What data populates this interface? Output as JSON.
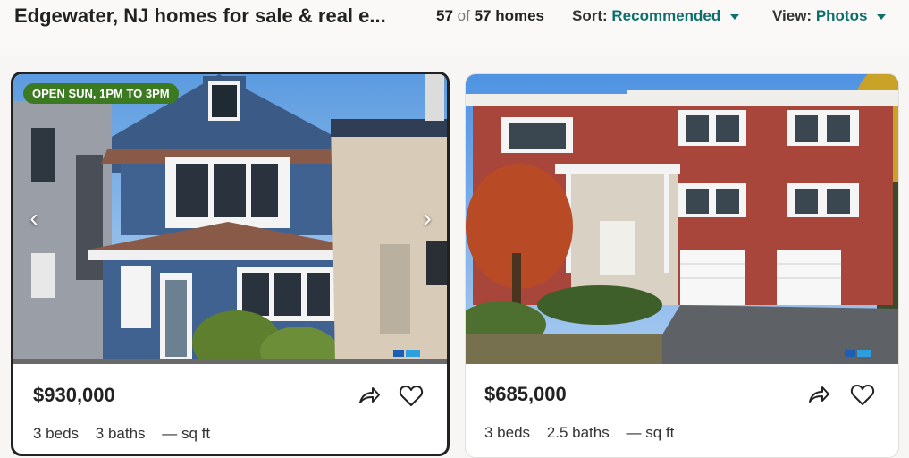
{
  "header": {
    "title": "Edgewater, NJ homes for sale & real e...",
    "count_shown": "57",
    "count_of": "of",
    "count_total": "57 homes",
    "sort_label": "Sort:",
    "sort_value": "Recommended",
    "view_label": "View:",
    "view_value": "Photos"
  },
  "listings": [
    {
      "badge": "OPEN SUN, 1PM TO 3PM",
      "price": "$930,000",
      "beds": "3 beds",
      "baths": "3 baths",
      "sqft": "— sq ft"
    },
    {
      "price": "$685,000",
      "beds": "3 beds",
      "baths": "2.5 baths",
      "sqft": "— sq ft"
    }
  ],
  "icons": {
    "prev": "chevron-left-icon",
    "next": "chevron-right-icon",
    "share": "share-icon",
    "favorite": "heart-icon",
    "sort_caret": "caret-down-icon",
    "view_caret": "caret-down-icon"
  },
  "colors": {
    "accent": "#0d6f6a",
    "badge": "#3c7a22"
  }
}
